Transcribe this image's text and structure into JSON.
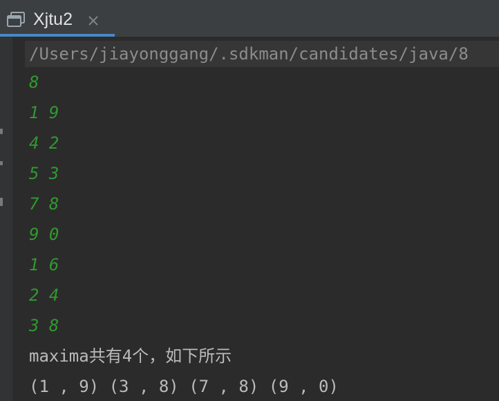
{
  "tab": {
    "title": "Xjtu2",
    "icon": "console-window-icon",
    "close_icon": "close-icon"
  },
  "console": {
    "command": "/Users/jiayonggang/.sdkman/candidates/java/8",
    "input_lines": [
      "8",
      "1 9",
      "4 2",
      "5 3",
      "7 8",
      "9 0",
      "1 6",
      "2 4",
      "3 8"
    ],
    "output_lines": [
      "maxima共有4个，如下所示",
      "(1 , 9) (3 , 8) (7 , 8) (9 , 0)"
    ]
  },
  "colors": {
    "background": "#2b2b2b",
    "tab_bar": "#3c3f41",
    "active_tab_underline": "#4a88c7",
    "input_text": "#2f9a2f",
    "output_text": "#bbbbbb",
    "command_text": "#8c8c8c"
  }
}
